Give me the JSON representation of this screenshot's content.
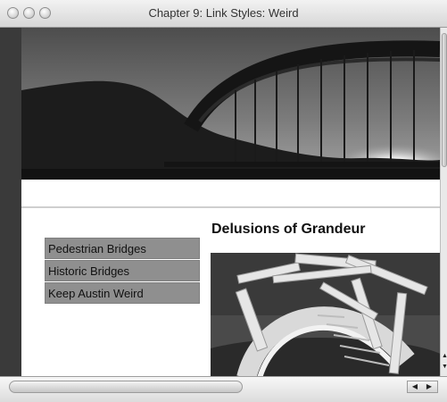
{
  "window": {
    "title": "Chapter 9: Link Styles: Weird"
  },
  "nav": {
    "items": [
      {
        "label": "Pedestrian Bridges"
      },
      {
        "label": "Historic Bridges"
      },
      {
        "label": "Keep Austin Weird"
      }
    ]
  },
  "main": {
    "heading": "Delusions of Grandeur"
  },
  "icons": {
    "close": "traffic-light-close",
    "minimize": "traffic-light-minimize",
    "zoom": "traffic-light-zoom",
    "scroll_left": "arrow-left",
    "scroll_right": "arrow-right",
    "scroll_up": "arrow-up",
    "scroll_down": "arrow-down"
  },
  "colors": {
    "nav_background": "#8f8f8f",
    "text": "#111111",
    "banner_dark": "#1f1f1f",
    "banner_sky": "#6c6c6c"
  }
}
